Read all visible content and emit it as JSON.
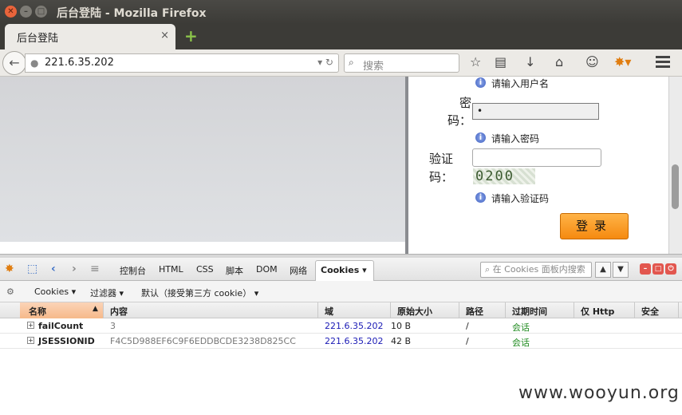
{
  "window": {
    "title": "后台登陆 - Mozilla Firefox",
    "close_glyph": "✕",
    "min_glyph": "–",
    "max_glyph": "□"
  },
  "tab": {
    "title": "后台登陆",
    "close_glyph": "×",
    "new_tab_glyph": "+"
  },
  "navbar": {
    "url": "221.6.35.202",
    "search_placeholder": "搜索"
  },
  "login_form": {
    "username_hint": "请输入用户名",
    "password_label_top": "密",
    "password_label_bottom": "码：",
    "password_value": "•",
    "password_hint": "请输入密码",
    "captcha_label_top": "验证",
    "captcha_label_bottom": "码：",
    "captcha_input_value": "",
    "captcha_image_text": "0200",
    "captcha_hint": "请输入验证码",
    "login_button": "登录"
  },
  "firebug": {
    "tabs": [
      "控制台",
      "HTML",
      "CSS",
      "脚本",
      "DOM",
      "网络"
    ],
    "active_tab": "Cookies",
    "search_placeholder": "在 Cookies 面板内搜索",
    "subtoolbar": {
      "cookies_menu": "Cookies",
      "filter_menu": "过滤器",
      "default_menu": "默认（接受第三方 cookie）"
    },
    "columns": [
      "名称",
      "内容",
      "域",
      "原始大小",
      "路径",
      "过期时间",
      "仅 Http",
      "安全"
    ],
    "rows": [
      {
        "name": "failCount",
        "value": "3",
        "domain": "221.6.35.202",
        "size": "10 B",
        "path": "/",
        "expires": "会话",
        "http_only": "",
        "secure": ""
      },
      {
        "name": "JSESSIONID",
        "value": "F4C5D988EF6C9F6EDDBCDE3238D825CC",
        "domain": "221.6.35.202",
        "size": "42 B",
        "path": "/",
        "expires": "会话",
        "http_only": "",
        "secure": ""
      }
    ]
  },
  "watermark": "www.wooyun.org",
  "colors": {
    "accent": "#f58a10",
    "titlebar": "#3c3b37",
    "domain_link": "#1a1ab5",
    "session": "#1e8a1e"
  }
}
